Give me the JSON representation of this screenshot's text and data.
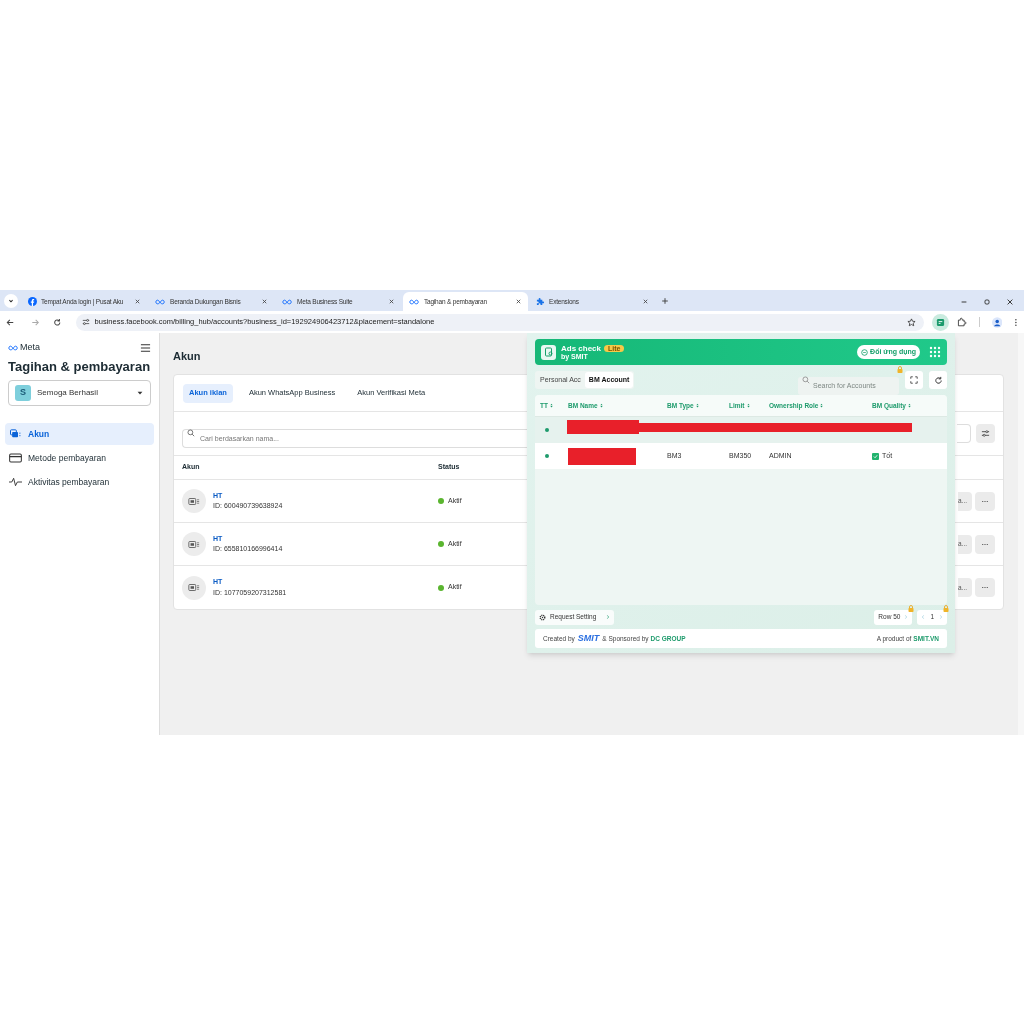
{
  "browser": {
    "tabs": [
      {
        "title": "Tempat Anda login | Pusat Aku",
        "kind": "facebook",
        "selected": false
      },
      {
        "title": "Beranda Dukungan Bisnis",
        "kind": "meta",
        "selected": false
      },
      {
        "title": "Meta Business Suite",
        "kind": "meta",
        "selected": false
      },
      {
        "title": "Tagihan & pembayaran",
        "kind": "meta",
        "selected": true
      },
      {
        "title": "Extensions",
        "kind": "puzzle",
        "selected": false
      }
    ],
    "url": "business.facebook.com/billing_hub/accounts?business_id=192924906423712&placement=standalone"
  },
  "sidebar": {
    "logo": "Meta",
    "title": "Tagihan & pembayaran",
    "business": {
      "initial": "S",
      "name": "Semoga Berhasil"
    },
    "items": [
      {
        "label": "Akun",
        "kind": "accounts",
        "selected": true
      },
      {
        "label": "Metode pembayaran",
        "kind": "card",
        "selected": false
      },
      {
        "label": "Aktivitas pembayaran",
        "kind": "activity",
        "selected": false
      }
    ]
  },
  "main": {
    "heading": "Akun",
    "tabs": [
      {
        "label": "Akun iklan",
        "selected": true
      },
      {
        "label": "Akun WhatsApp Business",
        "selected": false
      },
      {
        "label": "Akun Verifikasi Meta",
        "selected": false
      }
    ],
    "search": {
      "placeholder": "Cari berdasarkan nama..."
    },
    "columns": [
      "Akun",
      "Status"
    ],
    "rows": [
      {
        "name": "HT",
        "id": "ID: 600490739638924",
        "status": "Aktif",
        "action": "a..."
      },
      {
        "name": "HT",
        "id": "ID: 655810166996414",
        "status": "Aktif",
        "action": "a..."
      },
      {
        "name": "HT",
        "id": "ID: 1077059207312581",
        "status": "Aktif",
        "action": "a..."
      }
    ]
  },
  "extension": {
    "title": "Ads check",
    "badge": "Lite",
    "byline": "by SMIT",
    "switch_button": "Đổi ứng dụng",
    "tabs": [
      {
        "label": "Personal Acc",
        "selected": false
      },
      {
        "label": "BM Account",
        "selected": true
      }
    ],
    "search": {
      "placeholder": "Search for Accounts"
    },
    "columns": [
      "TT",
      "BM Name",
      "BM Type",
      "Limit",
      "Ownership Role",
      "BM Quality"
    ],
    "rows": [
      {
        "kind": "redacted_row"
      },
      {
        "kind": "redacted_name",
        "bm_type": "BM3",
        "limit": "BM350",
        "role": "ADMIN",
        "quality": "Tốt",
        "quality_checked": true
      }
    ],
    "request_setting": "Request Setting",
    "row_size": "Row 50",
    "page": "1",
    "footer": {
      "created_by": "Created by",
      "logo": "SMIT",
      "sponsored_by": "& Sponsored by",
      "sponsor": "DC GROUP",
      "product_of": "A product of",
      "product": "SMIT.VN"
    }
  }
}
